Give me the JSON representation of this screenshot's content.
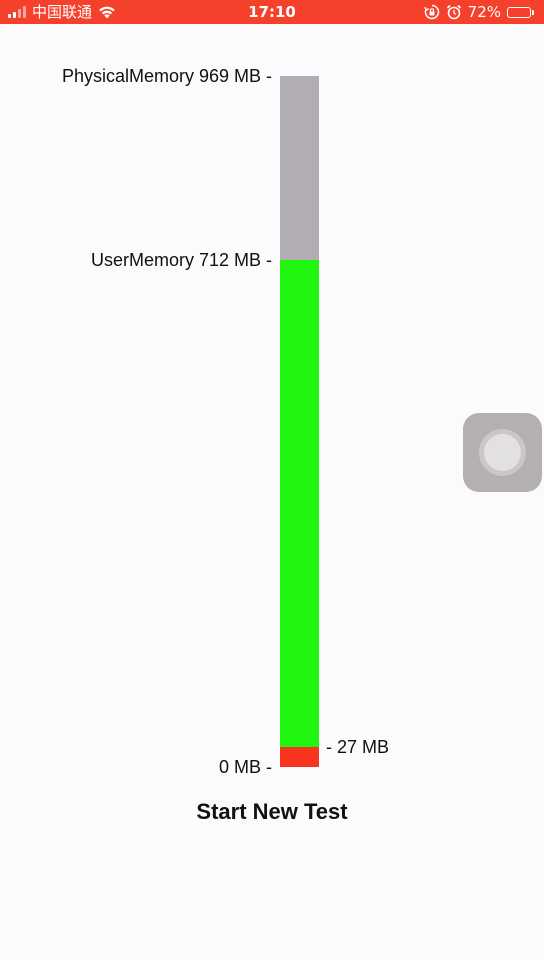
{
  "status_bar": {
    "carrier": "中国联通",
    "time": "17:10",
    "battery_percent": "72%",
    "battery_level": 0.72,
    "icons": [
      "signal-icon",
      "wifi-icon",
      "rotation-lock-icon",
      "alarm-icon",
      "battery-icon"
    ]
  },
  "memory": {
    "physical_label": "PhysicalMemory 969 MB -",
    "user_label": "UserMemory 712 MB -",
    "zero_label": "0 MB -",
    "used_label": "- 27 MB",
    "physical_mb": 969,
    "user_mb": 712,
    "used_mb": 27,
    "colors": {
      "physical": "#b2adb2",
      "user": "#20f510",
      "used": "#f8351e"
    }
  },
  "button": {
    "start_label": "Start New Test"
  },
  "colors": {
    "status_bar_bg": "#f5402c",
    "background": "#fbfbfd"
  }
}
